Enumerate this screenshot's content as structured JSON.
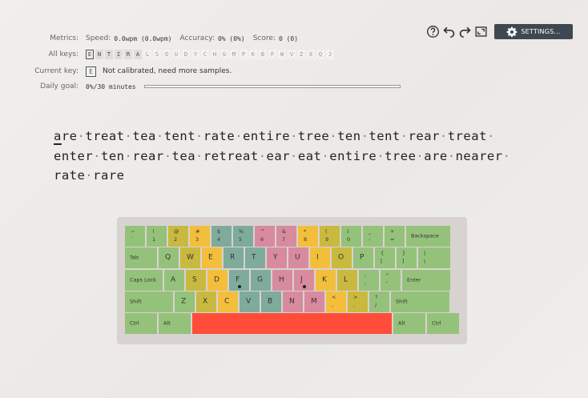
{
  "toolbar": {
    "help_icon": "question-circle-icon",
    "undo_icon": "undo-arrow-icon",
    "redo_icon": "redo-arrow-icon",
    "fullscreen_icon": "fullscreen-icon",
    "settings_icon": "gear-icon",
    "settings_label": "SETTINGS..."
  },
  "metrics": {
    "label": "Metrics:",
    "speed_label": "Speed:",
    "speed_value": "0.0wpm (0.0wpm)",
    "accuracy_label": "Accuracy:",
    "accuracy_value": "0% (0%)",
    "score_label": "Score:",
    "score_value": "0 (0)"
  },
  "all_keys": {
    "label": "All keys:",
    "keys": [
      "E",
      "N",
      "T",
      "I",
      "R",
      "A",
      "L",
      "S",
      "O",
      "U",
      "D",
      "Y",
      "C",
      "H",
      "G",
      "M",
      "P",
      "K",
      "B",
      "F",
      "W",
      "V",
      "Z",
      "X",
      "Q",
      "J"
    ],
    "included_count": 6
  },
  "current_key": {
    "label": "Current key:",
    "key": "E",
    "status": "Not calibrated, need more samples."
  },
  "daily_goal": {
    "label": "Daily goal:",
    "value": "0%/30 minutes",
    "progress": 0
  },
  "practice": {
    "lines": [
      [
        "are",
        "treat",
        "tea",
        "tent",
        "rate",
        "entire",
        "tree",
        "ten",
        "tent",
        "rear",
        "treat"
      ],
      [
        "enter",
        "ten",
        "rear",
        "tea",
        "retreat",
        "ear",
        "eat",
        "entire",
        "tree",
        "are",
        "nearer"
      ],
      [
        "rate",
        "rare"
      ]
    ],
    "cursor_word": 0,
    "cursor_char": 0
  },
  "keyboard": {
    "colors": {
      "g": "#95c27a",
      "y": "#f3be3c",
      "o": "#c9b93f",
      "t1": "#7eab9c",
      "p": "#d88a9f",
      "r": "#ff4d39"
    },
    "rows": [
      [
        {
          "t": "~",
          "b": "`",
          "c": "g"
        },
        {
          "t": "!",
          "b": "1",
          "c": "g"
        },
        {
          "t": "@",
          "b": "2",
          "c": "o"
        },
        {
          "t": "#",
          "b": "3",
          "c": "y"
        },
        {
          "t": "$",
          "b": "4",
          "c": "t1"
        },
        {
          "t": "%",
          "b": "5",
          "c": "t1"
        },
        {
          "t": "^",
          "b": "6",
          "c": "p"
        },
        {
          "t": "&",
          "b": "7",
          "c": "p"
        },
        {
          "t": "*",
          "b": "8",
          "c": "y"
        },
        {
          "t": "(",
          "b": "9",
          "c": "o"
        },
        {
          "t": ")",
          "b": "0",
          "c": "g"
        },
        {
          "t": "_",
          "b": "-",
          "c": "g"
        },
        {
          "t": "+",
          "b": "=",
          "c": "g"
        },
        {
          "w": "Backspace",
          "c": "g"
        }
      ],
      [
        {
          "w": "Tab",
          "c": "g"
        },
        {
          "k": "Q",
          "c": "g"
        },
        {
          "k": "W",
          "c": "o"
        },
        {
          "k": "E",
          "c": "y"
        },
        {
          "k": "R",
          "c": "t1"
        },
        {
          "k": "T",
          "c": "t1"
        },
        {
          "k": "Y",
          "c": "p"
        },
        {
          "k": "U",
          "c": "p"
        },
        {
          "k": "I",
          "c": "y"
        },
        {
          "k": "O",
          "c": "o"
        },
        {
          "k": "P",
          "c": "g"
        },
        {
          "t": "{",
          "b": "[",
          "c": "g"
        },
        {
          "t": "}",
          "b": "]",
          "c": "g"
        },
        {
          "t": "|",
          "b": "\\",
          "c": "g"
        }
      ],
      [
        {
          "w": "Caps Lock",
          "c": "g"
        },
        {
          "k": "A",
          "c": "g"
        },
        {
          "k": "S",
          "c": "o"
        },
        {
          "k": "D",
          "c": "y"
        },
        {
          "k": "F",
          "c": "t1",
          "bump": true
        },
        {
          "k": "G",
          "c": "t1"
        },
        {
          "k": "H",
          "c": "p"
        },
        {
          "k": "J",
          "c": "p",
          "bump": true
        },
        {
          "k": "K",
          "c": "y"
        },
        {
          "k": "L",
          "c": "o"
        },
        {
          "t": ":",
          "b": ";",
          "c": "g"
        },
        {
          "t": "\"",
          "b": "'",
          "c": "g"
        },
        {
          "w": "Enter",
          "c": "g"
        }
      ],
      [
        {
          "w": "Shift",
          "c": "g"
        },
        {
          "k": "Z",
          "c": "g"
        },
        {
          "k": "X",
          "c": "o"
        },
        {
          "k": "C",
          "c": "y"
        },
        {
          "k": "V",
          "c": "t1"
        },
        {
          "k": "B",
          "c": "t1"
        },
        {
          "k": "N",
          "c": "p"
        },
        {
          "k": "M",
          "c": "p"
        },
        {
          "t": "<",
          "b": ",",
          "c": "y"
        },
        {
          "t": ">",
          "b": ".",
          "c": "o"
        },
        {
          "t": "?",
          "b": "/",
          "c": "g"
        },
        {
          "w": "Shift",
          "c": "g"
        }
      ],
      [
        {
          "w": "Ctrl",
          "c": "g"
        },
        {
          "w": "Alt",
          "c": "g"
        },
        {
          "w": "",
          "c": "r"
        },
        {
          "w": "Alt",
          "c": "g"
        },
        {
          "w": "Ctrl",
          "c": "g"
        }
      ]
    ]
  }
}
